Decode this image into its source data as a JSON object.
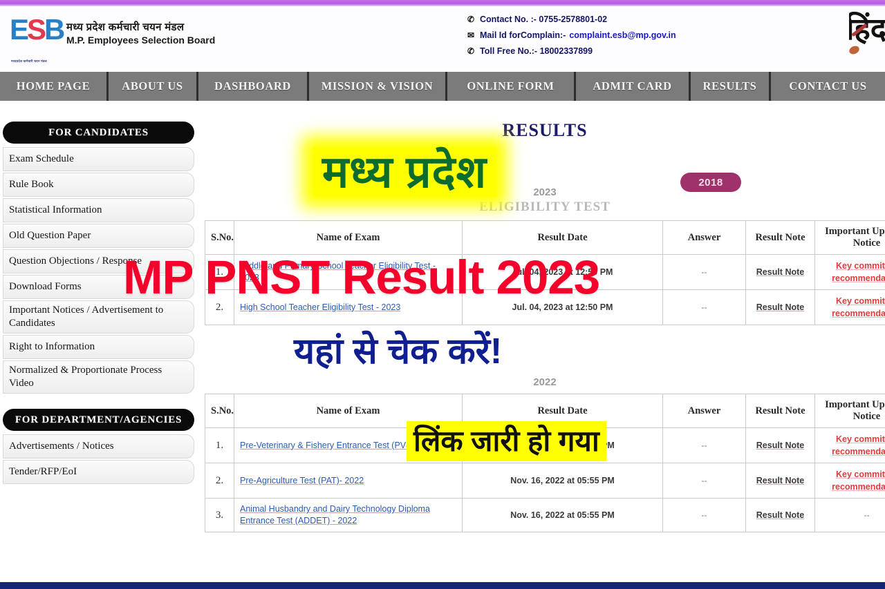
{
  "brand": {
    "logo_mark_letters": "ESB",
    "name_hindi": "मध्य प्रदेश कर्मचारी चयन मंडल",
    "name_english": "M.P. Employees Selection Board",
    "logo_micro_text": "मध्यप्रदेश कर्मचारी चयन मंडल",
    "hindi_side_logo": "हिंद"
  },
  "contact": {
    "phone_icon": "phone-icon",
    "phone_label": "Contact No. :- 0755-2578801-02",
    "mail_icon": "mail-icon",
    "mail_label": "Mail Id forComplain:-",
    "mail_value": "complaint.esb@mp.gov.in",
    "tollfree_icon": "phone-icon",
    "tollfree_label": "Toll Free No.:- 18002337899"
  },
  "nav": {
    "items": [
      {
        "label": "HOME PAGE"
      },
      {
        "label": "ABOUT US"
      },
      {
        "label": "DASHBOARD"
      },
      {
        "label": "MISSION & VISION"
      },
      {
        "label": "ONLINE FORM"
      },
      {
        "label": "ADMIT CARD"
      },
      {
        "label": "RESULTS"
      },
      {
        "label": "CONTACT US"
      }
    ]
  },
  "sidebar": {
    "candidates_heading": "FOR CANDIDATES",
    "candidates_items": [
      {
        "label": "Exam Schedule"
      },
      {
        "label": "Rule Book"
      },
      {
        "label": "Statistical Information"
      },
      {
        "label": "Old Question Paper"
      },
      {
        "label": "Question Objections / Response"
      },
      {
        "label": "Download Forms"
      },
      {
        "label": "Important Notices / Advertisement to Candidates"
      },
      {
        "label": "Right to Information"
      },
      {
        "label": "Normalized & Proportionate Process Video"
      }
    ],
    "department_heading": "FOR DEPARTMENT/AGENCIES",
    "department_items": [
      {
        "label": "Advertisements / Notices"
      },
      {
        "label": "Tender/RFP/EoI"
      }
    ]
  },
  "main": {
    "results_title": "RESULTS",
    "badge_year": "2018",
    "section_year": "2023",
    "section_subtitle": "ELIGIBILITY TEST",
    "table_2023": {
      "headers": [
        "S.No.",
        "Name of Exam",
        "Result Date",
        "Answer",
        "Result Note",
        "Important Update / Notice"
      ],
      "rows": [
        {
          "sno": "1.",
          "name": "Middle and Primary School Teacher Eligibility Test - 2023",
          "date": "Jul. 04, 2023 at 12:50 PM",
          "answer": "--",
          "note": "Result Note",
          "update": "Key committee recommendation"
        },
        {
          "sno": "2.",
          "name": "High School Teacher Eligibility Test - 2023",
          "date": "Jul. 04, 2023 at 12:50 PM",
          "answer": "--",
          "note": "Result Note",
          "update": "Key committee recommendation"
        }
      ]
    },
    "section_year_2022": "2022",
    "table_2022": {
      "headers": [
        "S.No.",
        "Name of Exam",
        "Result Date",
        "Answer",
        "Result Note",
        "Important Update / Notice"
      ],
      "rows": [
        {
          "sno": "1.",
          "name": "Pre-Veterinary & Fishery Entrance Test (PV&FT) - 2022",
          "date": "Nov. 23, 2022 at 05:55 PM",
          "answer": "--",
          "note": "Result Note",
          "update": "Key committee recommendation"
        },
        {
          "sno": "2.",
          "name": "Pre-Agriculture Test (PAT)- 2022",
          "date": "Nov. 16, 2022 at 05:55 PM",
          "answer": "--",
          "note": "Result Note",
          "update": "Key committee recommendation"
        },
        {
          "sno": "3.",
          "name": "Animal Husbandry and Dairy Technology Diploma Entrance Test (ADDET) - 2022",
          "date": "Nov. 16, 2022 at 05:55 PM",
          "answer": "--",
          "note": "Result Note",
          "update": "--"
        }
      ]
    }
  },
  "overlay": {
    "state_name": "मध्य प्रदेश",
    "headline": "MP PNST Result 2023",
    "cta": "यहां से चेक करें!",
    "status": "लिंक जारी हो गया"
  },
  "colors": {
    "top_strip": "#bb6ee0",
    "nav_bg": "#7b7b7b",
    "sidebar_heading_bg": "#0a0a0a",
    "overlay_green": "#0c6b2e",
    "overlay_yellow": "#ffff00",
    "overlay_red": "#f4002a",
    "overlay_blue": "#101f8f",
    "badge_maroon": "#a0326b",
    "link_blue": "#2b5bb5",
    "key_red": "#e23b3b",
    "bottom_strip": "#16237a"
  }
}
